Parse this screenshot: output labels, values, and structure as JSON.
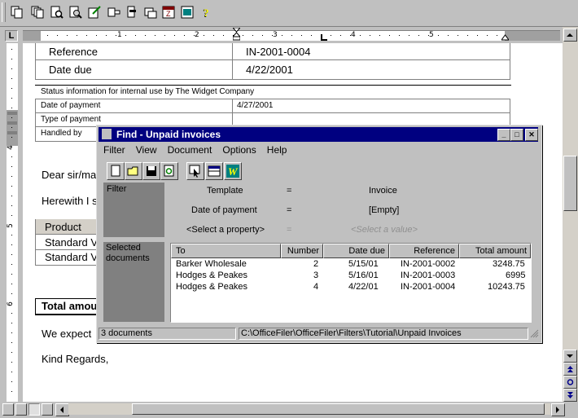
{
  "document": {
    "reference_label": "Reference",
    "reference_value": "IN-2001-0004",
    "date_due_label": "Date due",
    "date_due_value": "4/22/2001",
    "status_header": "Status information for internal use by The Widget Company",
    "date_of_payment_label": "Date of payment",
    "date_of_payment_value": "4/27/2001",
    "type_of_payment_label": "Type of payment",
    "handled_by_label": "Handled by",
    "dear": "Dear sir/ma",
    "herewith": "Herewith I s",
    "product_header": "Product",
    "row1": "Standard V",
    "row2": "Standard V",
    "total": "Total amou",
    "we_expect": "We expect",
    "kind_regards": "Kind Regards,"
  },
  "ruler": {
    "numbers": [
      "1",
      "2",
      "3",
      "4",
      "5"
    ],
    "vnumbers": [
      "4",
      "5",
      "6"
    ]
  },
  "dialog": {
    "title": "Find - Unpaid invoices",
    "menu": [
      "Filter",
      "View",
      "Document",
      "Options",
      "Help"
    ],
    "filter_label": "Filter",
    "selected_label": "Selected documents",
    "filters": [
      {
        "property": "Template",
        "op": "=",
        "value": "Invoice"
      },
      {
        "property": "Date of payment",
        "op": "=",
        "value": "[Empty]"
      },
      {
        "property": "<Select a property>",
        "op": "=",
        "value": "<Select a value>"
      }
    ],
    "columns": [
      "To",
      "Number",
      "Date due",
      "Reference",
      "Total amount"
    ],
    "rows": [
      {
        "to": "Barker Wholesale",
        "number": "2",
        "date_due": "5/15/01",
        "reference": "IN-2001-0002",
        "total": "3248.75"
      },
      {
        "to": "Hodges & Peakes",
        "number": "3",
        "date_due": "5/16/01",
        "reference": "IN-2001-0003",
        "total": "6995"
      },
      {
        "to": "Hodges & Peakes",
        "number": "4",
        "date_due": "4/22/01",
        "reference": "IN-2001-0004",
        "total": "10243.75"
      }
    ],
    "status_count": "3 documents",
    "status_path": "C:\\OfficeFiler\\OfficeFiler\\Filters\\Tutorial\\Unpaid Invoices"
  },
  "icons": [
    "copy-icon",
    "multi-copy-icon",
    "find-icon",
    "preview-icon",
    "edit-icon",
    "insert-field-icon",
    "field-icon",
    "window-icon",
    "date-icon",
    "properties-icon",
    "help-icon"
  ]
}
